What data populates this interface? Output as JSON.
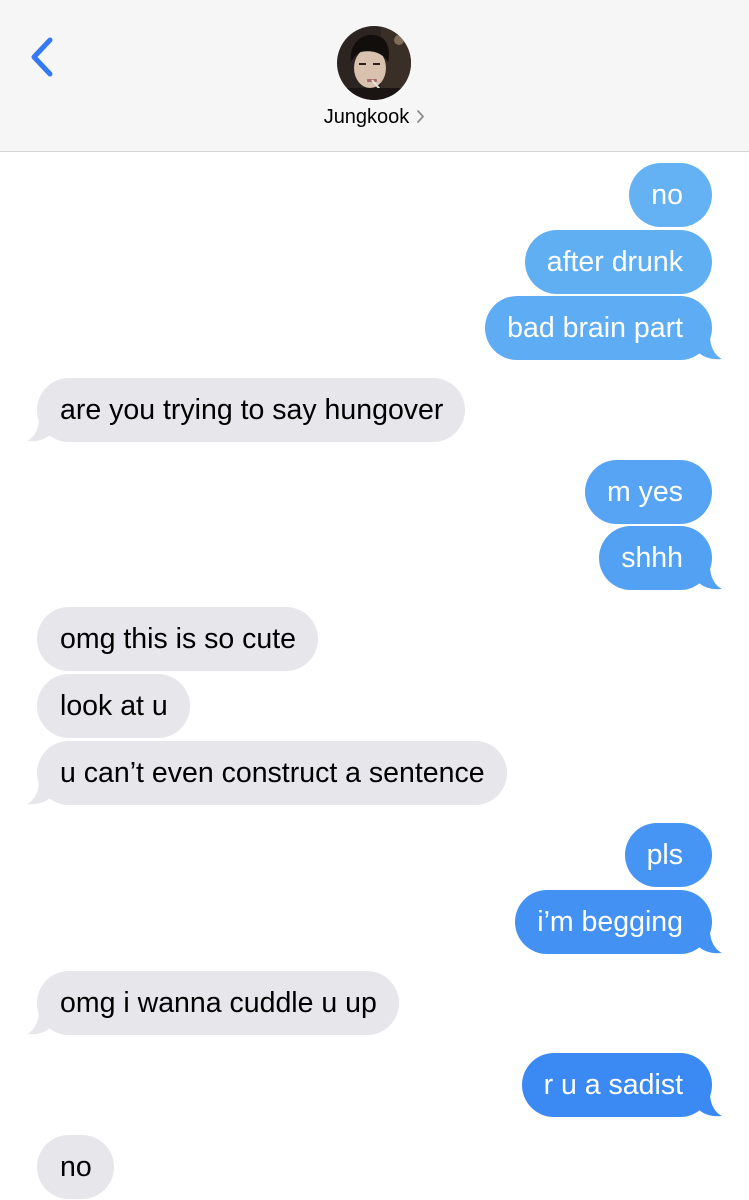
{
  "header": {
    "back_icon": "chevron-left-icon",
    "contact_name": "Jungkook",
    "contact_chevron_icon": "chevron-right-icon",
    "accent_color": "#3478f6"
  },
  "colors": {
    "outgoing_light": "#64b2f3",
    "outgoing_dark": "#3a88f3",
    "incoming": "#e6e6eb"
  },
  "messages": [
    {
      "sender": "me",
      "text": "no"
    },
    {
      "sender": "me",
      "text": "after drunk"
    },
    {
      "sender": "me",
      "text": "bad brain part"
    },
    {
      "sender": "them",
      "text": "are you trying to say hungover"
    },
    {
      "sender": "me",
      "text": "m yes"
    },
    {
      "sender": "me",
      "text": "shhh"
    },
    {
      "sender": "them",
      "text": "omg this is so cute"
    },
    {
      "sender": "them",
      "text": "look at u"
    },
    {
      "sender": "them",
      "text": "u can’t even construct a sentence"
    },
    {
      "sender": "me",
      "text": "pls"
    },
    {
      "sender": "me",
      "text": "i’m begging"
    },
    {
      "sender": "them",
      "text": "omg i wanna cuddle u up"
    },
    {
      "sender": "me",
      "text": "r u a sadist"
    },
    {
      "sender": "them",
      "text": "no"
    }
  ]
}
